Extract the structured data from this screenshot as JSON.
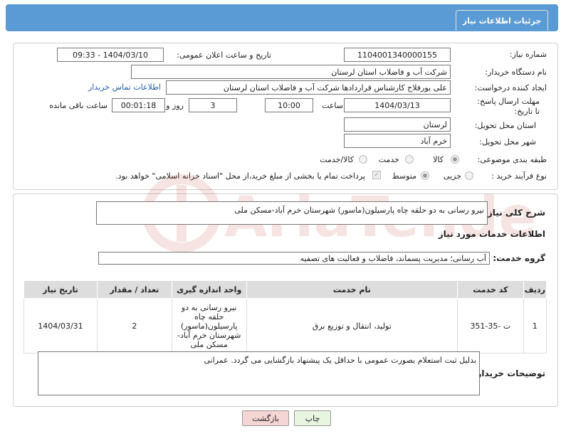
{
  "header": {
    "title": "جزئیات اطلاعات نیاز"
  },
  "fields": {
    "need_number_label": "شماره نیاز:",
    "need_number": "1104001340000155",
    "announce_label": "تاریخ و ساعت اعلان عمومی:",
    "announce_value": "1404/03/10 - 09:33",
    "buyer_org_label": "نام دستگاه خریدار:",
    "buyer_org": "شرکت آب و فاضلاب استان لرستان",
    "creator_label": "ایجاد کننده درخواست:",
    "creator": "علی یورفلاح کارشناس قراردادها شرکت آب و فاضلاب استان لرستان",
    "contact_link": "اطلاعات تماس خریدار",
    "deadline_label": "مهلت ارسال پاسخ: تا تاریخ:",
    "deadline_date": "1404/03/13",
    "time_label": "ساعت",
    "deadline_time": "10:00",
    "days_value": "3",
    "days_label": "روز و",
    "remaining_value": "00:01:18",
    "remaining_label": "ساعت باقی مانده",
    "province_label": "استان محل تحویل:",
    "province": "لرستان",
    "city_label": "شهر محل تحویل:",
    "city": "خرم آباد",
    "category_label": "طبقه بندی موضوعی:",
    "category_options": [
      "کالا",
      "خدمت",
      "کالا/خدمت"
    ],
    "process_label": "نوع فرآیند خرید :",
    "process_options": [
      "جزیی",
      "متوسط"
    ],
    "payment_note": "پرداخت تمام یا بخشی از مبلغ خرید،از محل \"اسناد خزانه اسلامی\" خواهد بود."
  },
  "description": {
    "label": "شرح کلی نیاز:",
    "value": "نیرو رسانی به دو حلقه چاه پارسیلون(ماسور) شهرستان خرم آباد-مسکن ملی"
  },
  "services": {
    "title": "اطلاعات خدمات مورد نیاز",
    "group_label": "گروه خدمت:",
    "group_value": "آب رسانی؛ مدیریت پسماند، فاضلاب و فعالیت های تصفیه",
    "columns": [
      "ردیف",
      "کد خدمت",
      "نام خدمت",
      "واحد اندازه گیری",
      "تعداد / مقدار",
      "تاریخ نیاز"
    ],
    "rows": [
      {
        "row": "1",
        "code": "ت -35-351",
        "name": "تولید، انتقال و توزیع برق",
        "unit": "نیرو رسانی به دو حلقه چاه پارسیلون(ماسور) شهرستان خرم آباد-مسکن ملی",
        "qty": "2",
        "date": "1404/03/31"
      }
    ]
  },
  "buyer_notes": {
    "label": "توضیحات خریدار:",
    "value": "بدلیل ثبت استعلام بصورت عمومی با حداقل یک پیشنهاد بازگشایی می گردد. عمرانی"
  },
  "buttons": {
    "print": "چاپ",
    "back": "بازگشت"
  },
  "watermark": {
    "text": "AriaTender.neT"
  },
  "colors": {
    "header": "#5b9bd5",
    "link": "#1f5fa8",
    "back_button": "#f6d5d5",
    "print_button": "#e8f5e0"
  }
}
